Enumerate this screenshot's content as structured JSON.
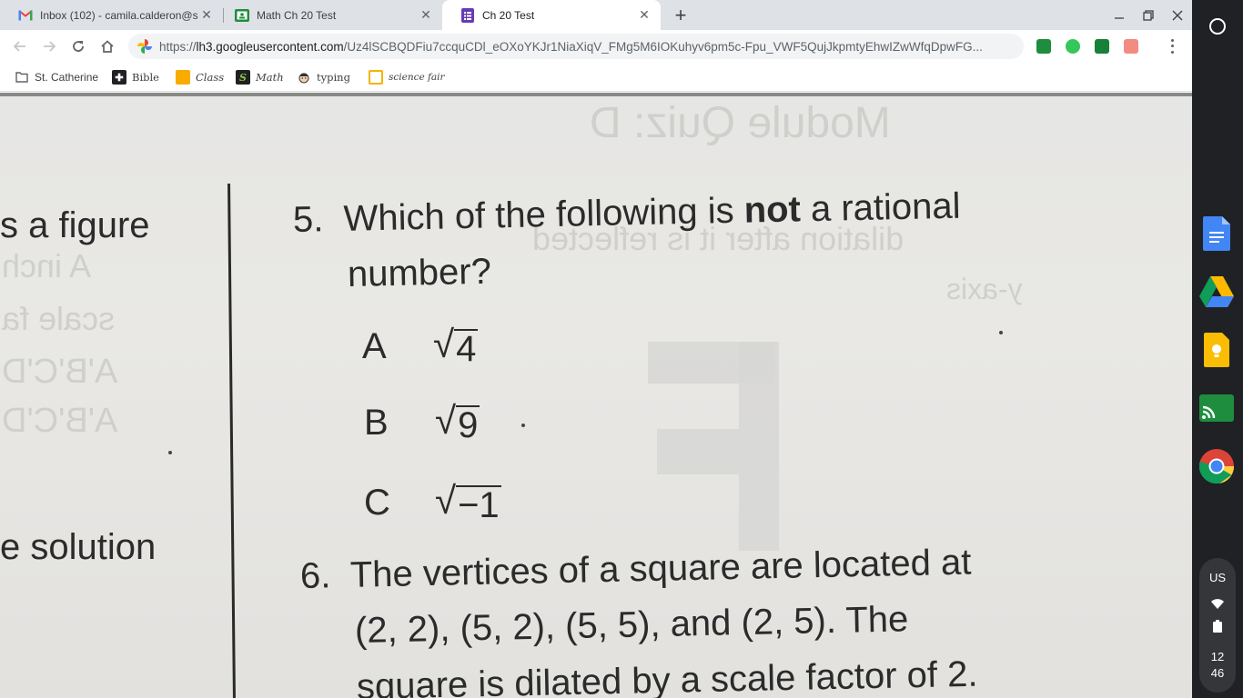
{
  "tabs": [
    {
      "title": "Inbox (102) - camila.calderon@s",
      "icon": "gmail-icon",
      "active": false
    },
    {
      "title": "Math Ch 20 Test",
      "icon": "classroom-icon",
      "active": false
    },
    {
      "title": "Ch 20 Test",
      "icon": "forms-icon",
      "active": true
    }
  ],
  "window_controls": {
    "new_tab": "+",
    "minimize": "–",
    "restore": "❐",
    "close": "✕"
  },
  "address_bar": {
    "scheme": "https://",
    "host": "lh3.googleusercontent.com",
    "path": "/Uz4lSCBQDFiu7ccquCDl_eOXoYKJr1NiaXiqV_FMg5M6IOKuhyv6pm5c-Fpu_VWF5QujJkpmtyEhwIZwWfqDpwFG..."
  },
  "bookmarks": [
    {
      "label": "St. Catherine",
      "icon": "folder-icon"
    },
    {
      "label": "Bible",
      "icon": "bible-icon"
    },
    {
      "label": "Class",
      "icon": "classroom-icon"
    },
    {
      "label": "Math",
      "icon": "math-icon"
    },
    {
      "label": "typing",
      "icon": "typing-icon"
    },
    {
      "label": "science fair",
      "icon": "slides-icon"
    }
  ],
  "worksheet": {
    "left_fragments": [
      "s a figure",
      "e solution"
    ],
    "question5": {
      "number": "5.",
      "text_before": "Which of the following is ",
      "emphasis": "not",
      "text_after": " a rational",
      "line2": "number?",
      "options": [
        {
          "letter": "A",
          "radicand": "4"
        },
        {
          "letter": "B",
          "radicand": "9"
        },
        {
          "letter": "C",
          "radicand": "−1"
        }
      ]
    },
    "question6": {
      "number": "6.",
      "line1": "The vertices of a square are located at",
      "line2": "(2, 2), (5, 2), (5, 5), and (2, 5). The",
      "line3": "square is dilated by a scale factor of 2."
    },
    "bleed_through": {
      "header": "Module Quiz: D",
      "frag1": "dilation after it is reflected",
      "frag2": "y-axis",
      "left1": "A inch",
      "left2": "scale fa",
      "left3": "A'B'C'D",
      "left4": "A'B'C'D"
    }
  },
  "shelf": {
    "apps": [
      "docs-icon",
      "drive-icon",
      "keep-icon",
      "cast-icon",
      "chrome-icon"
    ],
    "input_method": "US",
    "clock_hour": "12",
    "clock_minute": "46"
  }
}
